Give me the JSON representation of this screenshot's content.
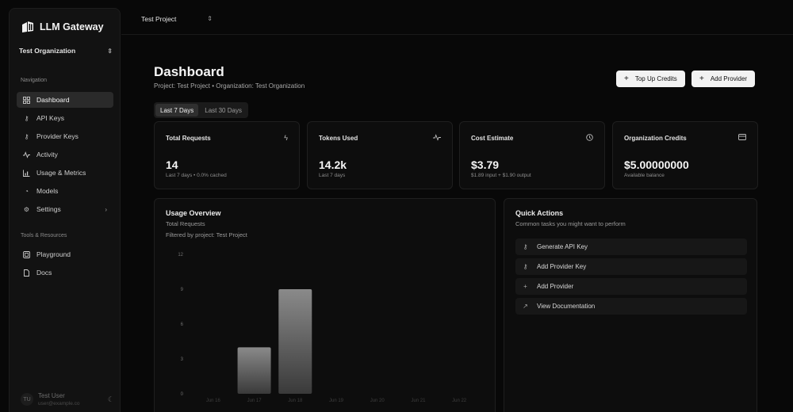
{
  "sidebar": {
    "brand": "LLM Gateway",
    "org": "Test Organization",
    "navigation_label": "Navigation",
    "nav": [
      {
        "label": "Dashboard",
        "icon": "grid-icon",
        "active": true
      },
      {
        "label": "API Keys",
        "icon": "key-icon"
      },
      {
        "label": "Provider Keys",
        "icon": "key-icon"
      },
      {
        "label": "Activity",
        "icon": "activity-icon"
      },
      {
        "label": "Usage & Metrics",
        "icon": "bar-chart-icon"
      },
      {
        "label": "Models",
        "icon": "models-icon"
      },
      {
        "label": "Settings",
        "icon": "gear-icon",
        "has_submenu": true
      }
    ],
    "tools_label": "Tools & Resources",
    "tools": [
      {
        "label": "Playground",
        "icon": "playground-icon"
      },
      {
        "label": "Docs",
        "icon": "doc-icon"
      }
    ],
    "user": {
      "initials": "TU",
      "name": "Test User",
      "email": "user@example.co"
    }
  },
  "topbar": {
    "project": "Test Project"
  },
  "header": {
    "title": "Dashboard",
    "subtitle": "Project: Test Project  • Organization: Test Organization",
    "top_up_label": "Top Up Credits",
    "add_provider_label": "Add Provider"
  },
  "range_tabs": [
    {
      "label": "Last 7 Days",
      "active": true
    },
    {
      "label": "Last 30 Days",
      "active": false
    }
  ],
  "stats": [
    {
      "title": "Total Requests",
      "icon": "zap-icon",
      "value": "14",
      "sub": "Last 7 days • 0.0% cached"
    },
    {
      "title": "Tokens Used",
      "icon": "activity-icon",
      "value": "14.2k",
      "sub": "Last 7 days"
    },
    {
      "title": "Cost Estimate",
      "icon": "clock-icon",
      "value": "$3.79",
      "sub": "$1.89 input + $1.90 output"
    },
    {
      "title": "Organization Credits",
      "icon": "credit-card-icon",
      "value": "$5.00000000",
      "sub": "Available balance"
    }
  ],
  "usage": {
    "title": "Usage Overview",
    "subtitle": "Total Requests",
    "filter": "Filtered by project: Test Project"
  },
  "chart_data": {
    "type": "bar",
    "categories": [
      "Jun 16",
      "Jun 17",
      "Jun 18",
      "Jun 19",
      "Jun 20",
      "Jun 21",
      "Jun 22"
    ],
    "values": [
      0,
      4,
      9,
      0,
      0,
      0,
      0
    ],
    "ylim": [
      0,
      12
    ],
    "yticks": [
      0,
      3,
      6,
      9,
      12
    ],
    "grid": false
  },
  "quick_actions": {
    "title": "Quick Actions",
    "subtitle": "Common tasks you might want to perform",
    "items": [
      {
        "label": "Generate API Key",
        "icon": "key-icon"
      },
      {
        "label": "Add Provider Key",
        "icon": "key-icon"
      },
      {
        "label": "Add Provider",
        "icon": "plus-icon"
      },
      {
        "label": "View Documentation",
        "icon": "arrow-up-right-icon"
      }
    ]
  }
}
